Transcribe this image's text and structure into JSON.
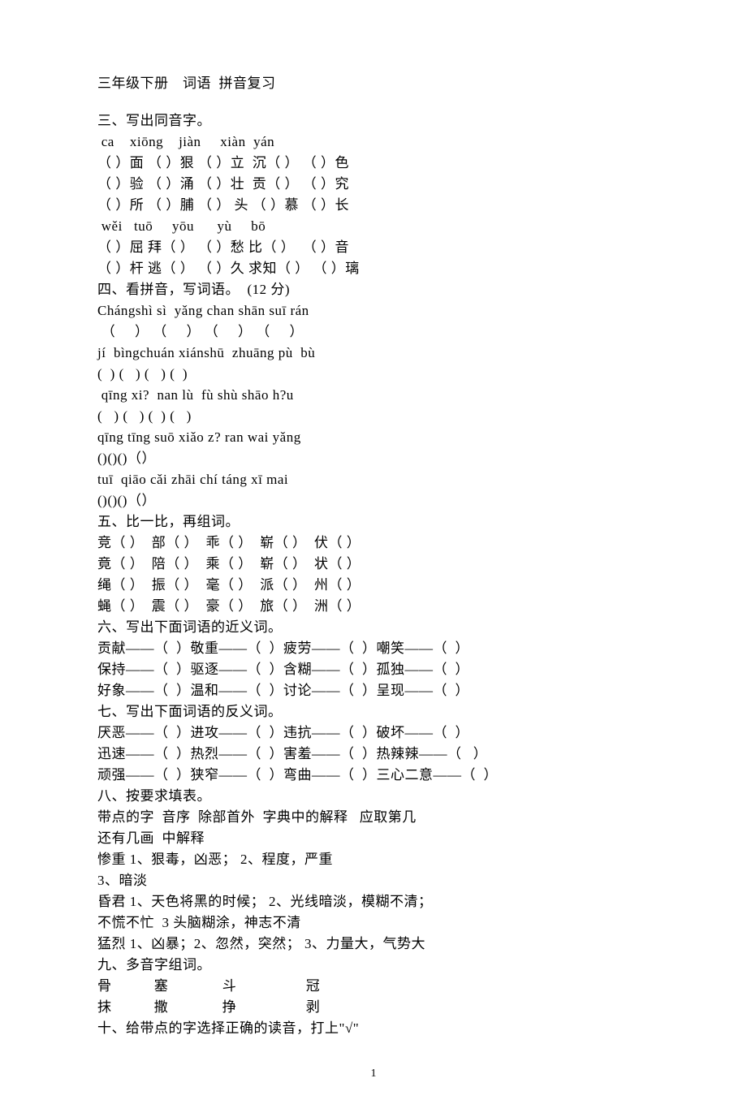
{
  "title": "三年级下册　词语  拼音复习",
  "section3_title": "三、写出同音字。",
  "s3_l1": " ca    xiōng    jiàn     xiàn  yán",
  "s3_l2": "（ ）面 （ ）狠 （ ）立  沉（ ） （ ）色",
  "s3_l3": "（ ）验 （ ）涌 （ ）壮  贡（ ） （ ）究",
  "s3_l4": "（ ）所 （ ）脯 （ ） 头 （ ）慕 （ ）长",
  "s3_l5": " wěi   tuō     yōu      yù     bō",
  "s3_l6": "（ ）屈 拜（ ） （ ）愁 比（ ）  （ ）音",
  "s3_l7": "（ ）杆 逃（ ） （ ）久 求知（ ） （ ）璃",
  "section4_title": "四、看拼音，写词语。  (12 分)",
  "s4_l1": "Chángshì sì  yǎng chan shān suī rán",
  "s4_l2": " （     ） （     ） （     ） （     ）",
  "s4_l3": "jí  bìngchuán xiánshū  zhuāng pù  bù",
  "s4_l4": "(  ) (   ) (   ) (  )",
  "s4_l5": " qīng xi?  nan lù  fù shù shāo h?u",
  "s4_l6": "(   ) (   ) (  ) (   )",
  "s4_l7": "qīng tīng suō xiǎo z? ran wai yǎng",
  "s4_l8": "()()()（）",
  "s4_l9": "tuī  qiāo cǎi zhāi chí táng xī mai",
  "s4_l10": "()()()（）",
  "section5_title": "五、比一比，再组词。",
  "s5_l1": "竞（ ）  部（ ）  乖（ ）  崭（ ）  伏（ ）",
  "s5_l2": "竟（ ）  陪（ ）  乘（ ）  崭（ ）  状（ ）",
  "s5_l3": "绳（ ）  振（ ）  毫（ ）  派（ ）  州（ ）",
  "s5_l4": "蝇（ ）  震（ ）  豪（ ）  旅（ ）  洲（ ）",
  "section6_title": "六、写出下面词语的近义词。",
  "s6_l1": "贡献——（  ）敬重——（  ）疲劳——（  ）嘲笑——（  ）",
  "s6_l2": "保持——（  ）驱逐——（  ）含糊——（  ）孤独——（  ）",
  "s6_l3": "好象——（  ）温和——（  ）讨论——（  ）呈现——（  ）",
  "section7_title": "七、写出下面词语的反义词。",
  "s7_l1": "厌恶——（  ）进攻——（  ）违抗——（  ）破坏——（  ）",
  "s7_l2": "迅速——（  ）热烈——（  ）害羞——（  ）热辣辣——（   ）",
  "s7_l3": "顽强——（  ）狭窄——（  ）弯曲——（  ）三心二意——（  ）",
  "section8_title": "八、按要求填表。",
  "s8_l1": "带点的字  音序  除部首外  字典中的解释   应取第几",
  "s8_l2": "还有几画  中解释",
  "s8_l3": "惨重 1、狠毒，凶恶； 2、程度，严重",
  "s8_l4": "3、暗淡",
  "s8_l5": "昏君 1、天色将黑的时候； 2、光线暗淡，模糊不清；",
  "s8_l6": "不慌不忙  3 头脑糊涂，神志不清",
  "s8_l7": "猛烈 1、凶暴；2、忽然，突然； 3、力量大，气势大",
  "section9_title": "九、多音字组词。",
  "s9_l1": "骨           塞              斗                  冠",
  "s9_l2": "抹           撒              挣                  剥",
  "section10_title": "十、给带点的字选择正确的读音，打上\"√\"",
  "page_number": "1"
}
